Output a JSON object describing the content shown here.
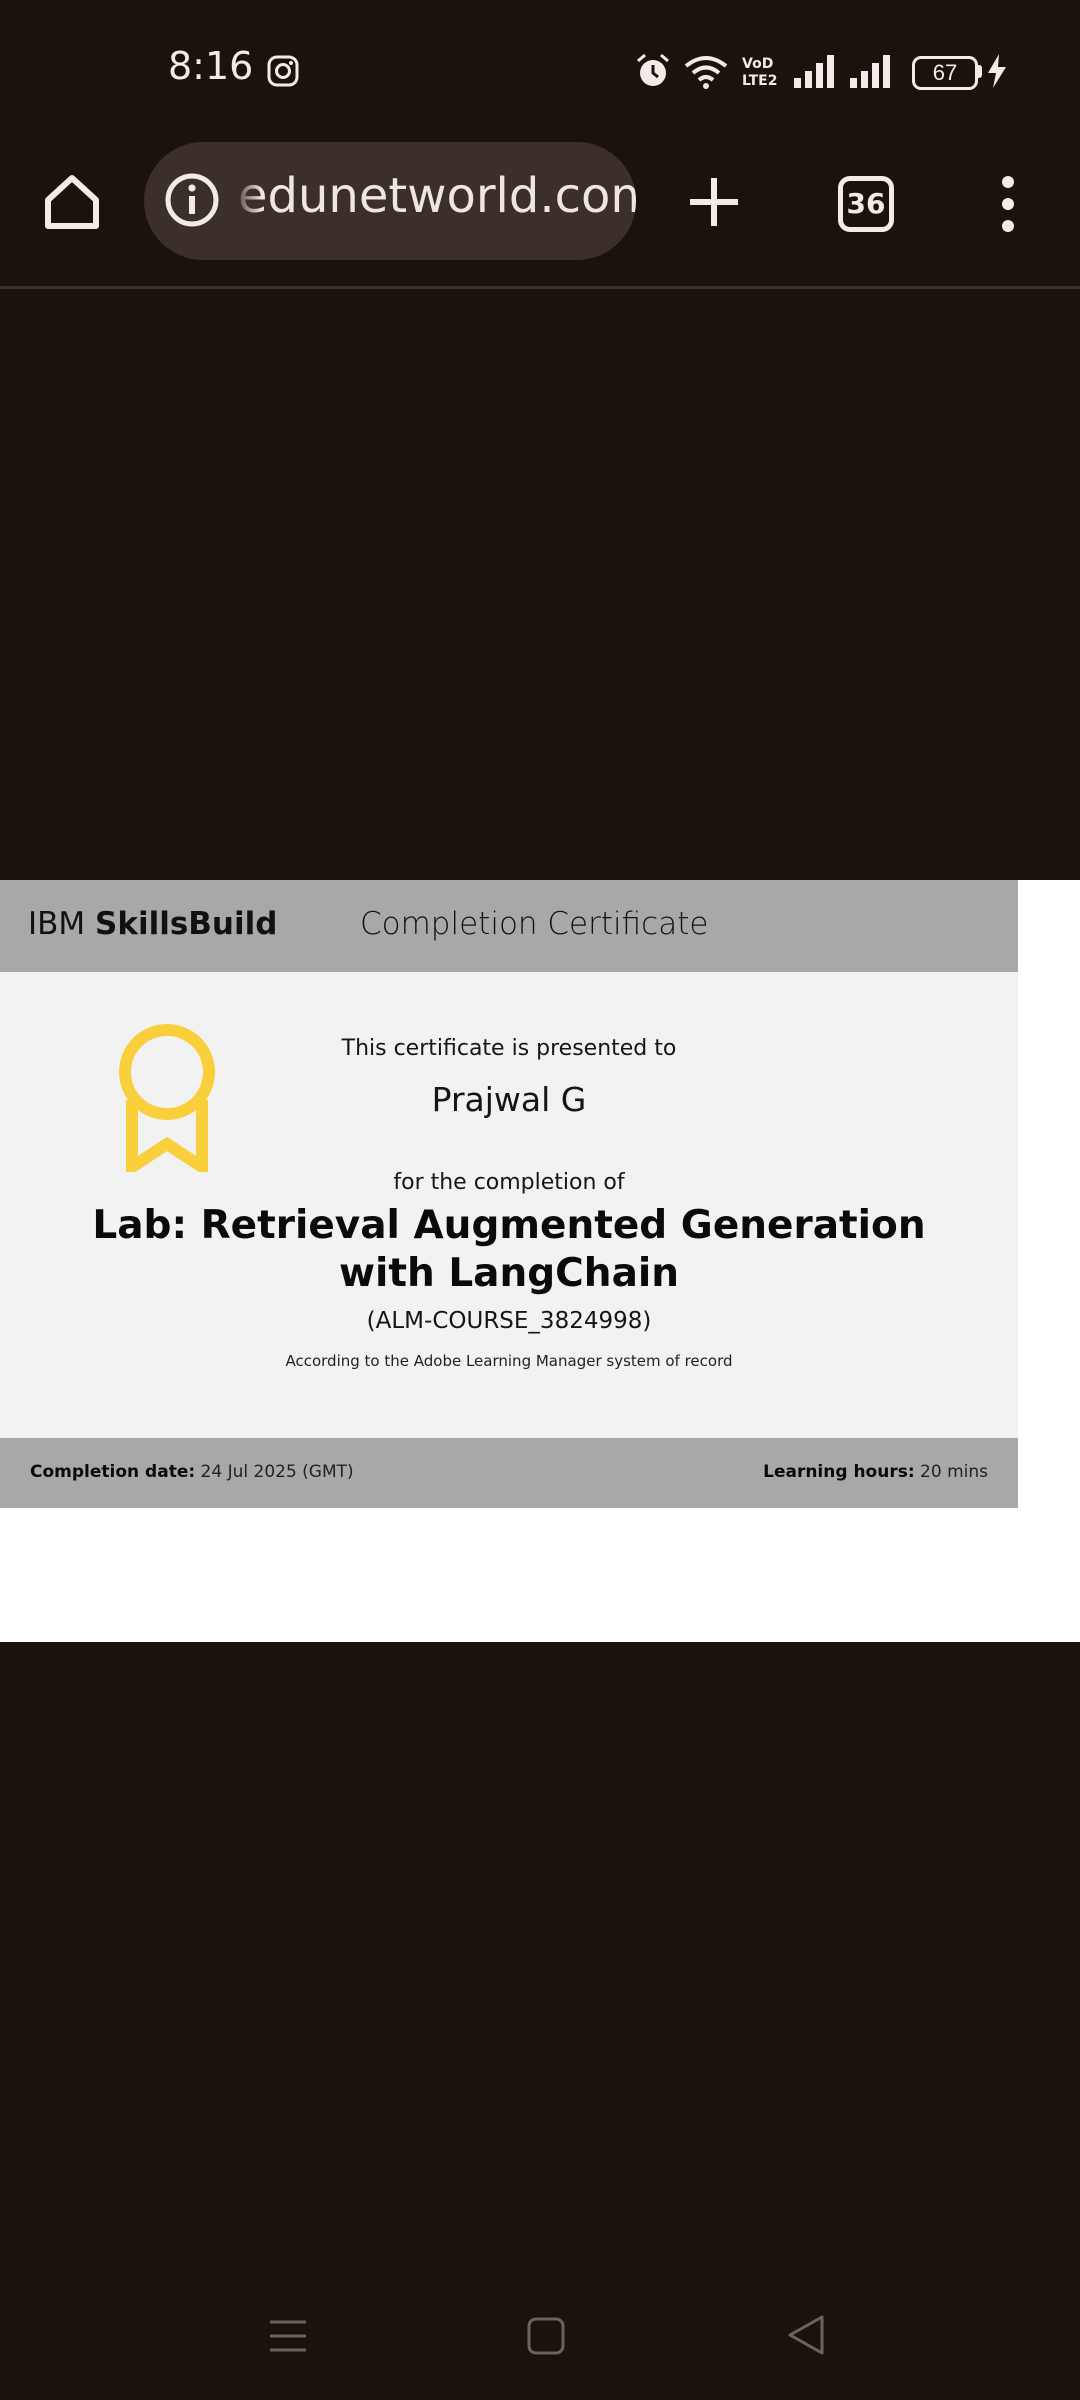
{
  "status_bar": {
    "time": "8:16",
    "battery": "67",
    "icons": [
      "instagram-icon",
      "alarm-icon",
      "wifi-icon",
      "volte-icon",
      "signal-icon",
      "signal-icon",
      "battery-icon",
      "charging-icon"
    ]
  },
  "browser": {
    "url": "edunetworld.com",
    "tab_count": "36",
    "icons": [
      "home-icon",
      "info-icon",
      "plus-icon",
      "tabs-icon",
      "more-vert-icon"
    ]
  },
  "certificate": {
    "brand_prefix": "IBM ",
    "brand_bold": "SkillsBuild",
    "header_title": "Completion Certificate",
    "presented_to": "This certificate is presented to",
    "recipient": "Prajwal G",
    "for_completion": "for the completion of",
    "course_title": "Lab: Retrieval Augmented Generation with LangChain",
    "course_code": "(ALM-COURSE_3824998)",
    "record_note": "According to the Adobe Learning Manager system of record",
    "completion_label": "Completion date:",
    "completion_value": " 24 Jul 2025 (GMT)",
    "hours_label": "Learning hours:",
    "hours_value": " 20 mins",
    "accent_color": "#f9cf3c"
  },
  "nav_bar": {
    "icons": [
      "menu-icon",
      "home-square-icon",
      "back-triangle-icon"
    ]
  }
}
